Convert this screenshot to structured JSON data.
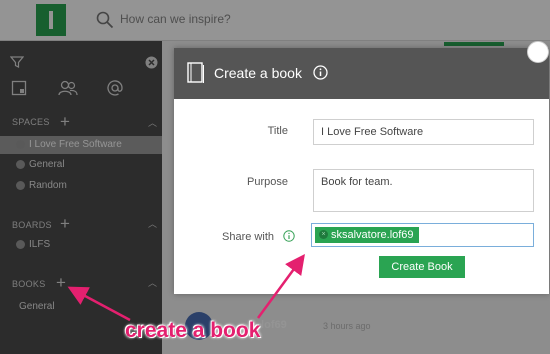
{
  "topbar": {
    "search_placeholder": "How can we inspire?"
  },
  "sidebar": {
    "spaces_label": "SPACES",
    "spaces": [
      "I Love Free Software",
      "General",
      "Random"
    ],
    "boards_label": "BOARDS",
    "boards": [
      "ILFS"
    ],
    "books_label": "BOOKS",
    "books": [
      "General"
    ]
  },
  "background": {
    "post_user": ".lof69",
    "post_time": "3 hours ago"
  },
  "modal": {
    "title": "Create a book",
    "title_label": "Title",
    "title_value": "I Love Free Software",
    "purpose_label": "Purpose",
    "purpose_value": "Book for team.",
    "share_label": "Share with",
    "share_tag": "sksalvatore.lof69",
    "create_button": "Create Book"
  },
  "annotation": {
    "text": "create a book"
  },
  "colors": {
    "accent": "#2aa452",
    "annotation": "#e4206f",
    "sidebar": "#4d4d4d",
    "modal_header": "#555555"
  }
}
